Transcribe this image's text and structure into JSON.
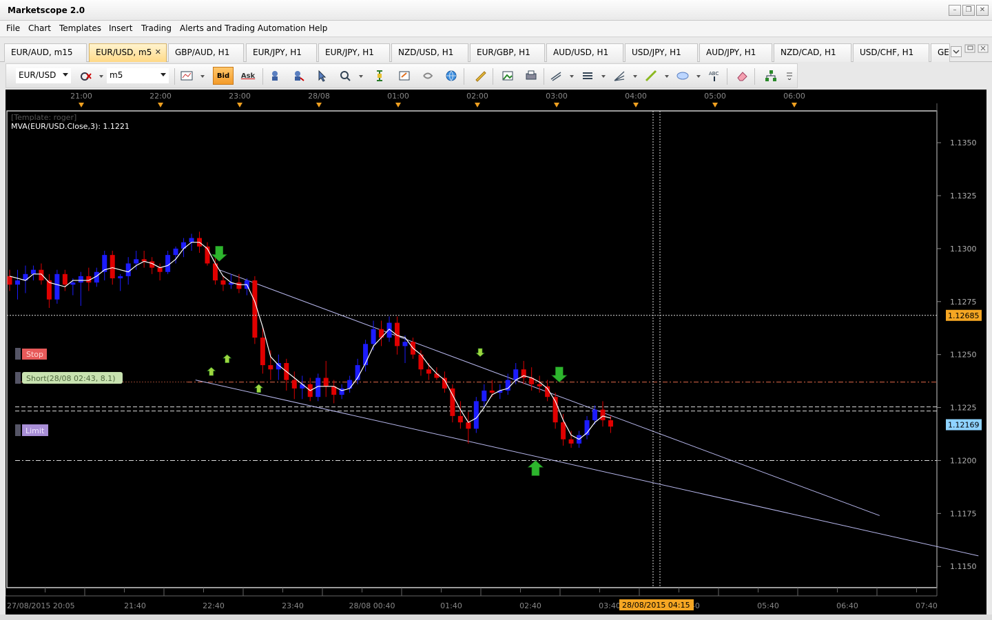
{
  "window": {
    "title": "Marketscope 2.0",
    "minimize": "–",
    "restore": "❐",
    "close": "✕"
  },
  "menu": [
    "File",
    "Chart",
    "Templates",
    "Insert",
    "Trading",
    "Alerts and Trading Automation",
    "Help"
  ],
  "tabs": [
    {
      "label": "EUR/AUD, m15",
      "active": false
    },
    {
      "label": "EUR/USD, m5",
      "active": true
    },
    {
      "label": "GBP/AUD, H1",
      "active": false
    },
    {
      "label": "EUR/JPY, H1",
      "active": false
    },
    {
      "label": "EUR/JPY, H1",
      "active": false
    },
    {
      "label": "NZD/USD, H1",
      "active": false
    },
    {
      "label": "EUR/GBP, H1",
      "active": false
    },
    {
      "label": "AUD/USD, H1",
      "active": false
    },
    {
      "label": "USD/JPY, H1",
      "active": false
    },
    {
      "label": "AUD/JPY, H1",
      "active": false
    },
    {
      "label": "NZD/CAD, H1",
      "active": false
    },
    {
      "label": "USD/CHF, H1",
      "active": false
    },
    {
      "label": "GE",
      "active": false
    }
  ],
  "tab_close": "✕",
  "toolbar": {
    "instrument": "EUR/USD",
    "timeframe": "m5",
    "bid_label": "Bid",
    "ask_label": "Ask",
    "tools": [
      "chart-type-icon",
      "bid-button",
      "ask-button",
      "indicator-icon",
      "strategy-icon",
      "cursor-icon",
      "zoom-icon",
      "signal-icon",
      "order-icon",
      "stream-icon",
      "globe-icon",
      "ruler-icon",
      "picture-icon",
      "print-icon",
      "line-tools-icon",
      "level-icon",
      "fibonacci-icon",
      "trendline-icon",
      "ellipse-icon",
      "text-icon",
      "eraser-icon",
      "hierarchy-icon",
      "more-icon"
    ]
  },
  "chart_data": {
    "type": "candlestick",
    "template_label": "[Template: roger]",
    "indicator_label": "MVA(EUR/USD.Close,3): 1.1221",
    "ylim": [
      1.114,
      1.1365
    ],
    "y_ticks": [
      "1.1350",
      "1.1325",
      "1.1300",
      "1.1275",
      "1.1250",
      "1.1225",
      "1.1200",
      "1.1175",
      "1.1150"
    ],
    "top_time_ticks": [
      "21:00",
      "22:00",
      "23:00",
      "28/08",
      "01:00",
      "02:00",
      "03:00",
      "04:00",
      "05:00",
      "06:00"
    ],
    "bottom_time_ticks": [
      "27/08/2015 20:05",
      "21:40",
      "22:40",
      "23:40",
      "28/08 00:40",
      "01:40",
      "02:40",
      "03:40",
      "04:40",
      "05:40",
      "06:40",
      "07:40"
    ],
    "cursor_time": "28/08/2015 04:15",
    "cursor_price": "1.12685",
    "last_price": "1.12169",
    "stop_label": "Stop",
    "stop_level": 1.1237,
    "limit_label": "Limit",
    "limit_level": 1.12,
    "position_label": "Short(28/08 02:43, 8.1)",
    "position_level": 1.1224,
    "colors": {
      "up": "#1c1cff",
      "down": "#e00000",
      "ma": "#ffffff",
      "trend": "#b8b8ee",
      "bg": "#000000",
      "axis_text": "#b0b0b0",
      "cursor_badge": "#f5a623",
      "price_badge": "#8fd3ff"
    },
    "candles": [
      [
        1.1287,
        1.129,
        1.128,
        1.1283
      ],
      [
        1.1283,
        1.129,
        1.1276,
        1.1285
      ],
      [
        1.1285,
        1.1292,
        1.1279,
        1.1288
      ],
      [
        1.1288,
        1.1292,
        1.1285,
        1.129
      ],
      [
        1.129,
        1.1293,
        1.1283,
        1.1285
      ],
      [
        1.1285,
        1.1288,
        1.1272,
        1.1276
      ],
      [
        1.1276,
        1.129,
        1.1274,
        1.1288
      ],
      [
        1.1288,
        1.129,
        1.128,
        1.1283
      ],
      [
        1.1283,
        1.1286,
        1.1278,
        1.1284
      ],
      [
        1.1284,
        1.1289,
        1.1273,
        1.1287
      ],
      [
        1.1287,
        1.1291,
        1.128,
        1.1284
      ],
      [
        1.1284,
        1.1291,
        1.1282,
        1.1289
      ],
      [
        1.1289,
        1.1299,
        1.1285,
        1.1297
      ],
      [
        1.1297,
        1.1299,
        1.1283,
        1.1286
      ],
      [
        1.1286,
        1.1288,
        1.128,
        1.1287
      ],
      [
        1.1287,
        1.1296,
        1.1283,
        1.1293
      ],
      [
        1.1293,
        1.1299,
        1.129,
        1.1295
      ],
      [
        1.1295,
        1.1299,
        1.1291,
        1.1294
      ],
      [
        1.1294,
        1.1296,
        1.1288,
        1.1291
      ],
      [
        1.1291,
        1.1293,
        1.1285,
        1.1289
      ],
      [
        1.1289,
        1.1299,
        1.1288,
        1.1297
      ],
      [
        1.1297,
        1.1301,
        1.1293,
        1.13
      ],
      [
        1.13,
        1.1305,
        1.1296,
        1.1303
      ],
      [
        1.1303,
        1.1307,
        1.1299,
        1.1305
      ],
      [
        1.1305,
        1.1308,
        1.1298,
        1.1301
      ],
      [
        1.1301,
        1.1303,
        1.1292,
        1.1293
      ],
      [
        1.1293,
        1.1296,
        1.1283,
        1.1285
      ],
      [
        1.1285,
        1.1287,
        1.128,
        1.1283
      ],
      [
        1.1283,
        1.1288,
        1.1281,
        1.1284
      ],
      [
        1.1284,
        1.1288,
        1.1279,
        1.1281
      ],
      [
        1.1281,
        1.1286,
        1.1278,
        1.1285
      ],
      [
        1.1285,
        1.1287,
        1.1255,
        1.1258
      ],
      [
        1.1258,
        1.1263,
        1.1241,
        1.1245
      ],
      [
        1.1245,
        1.1252,
        1.1238,
        1.1243
      ],
      [
        1.1243,
        1.125,
        1.1238,
        1.1246
      ],
      [
        1.1246,
        1.1248,
        1.1233,
        1.1238
      ],
      [
        1.1238,
        1.1242,
        1.1229,
        1.1234
      ],
      [
        1.1234,
        1.124,
        1.1229,
        1.1236
      ],
      [
        1.1236,
        1.1239,
        1.1228,
        1.123
      ],
      [
        1.123,
        1.1241,
        1.1228,
        1.1239
      ],
      [
        1.1239,
        1.1247,
        1.123,
        1.1235
      ],
      [
        1.1235,
        1.1238,
        1.1227,
        1.1231
      ],
      [
        1.1231,
        1.1236,
        1.1229,
        1.1234
      ],
      [
        1.1234,
        1.124,
        1.1232,
        1.1238
      ],
      [
        1.1238,
        1.1248,
        1.1236,
        1.1245
      ],
      [
        1.1245,
        1.1257,
        1.1242,
        1.1255
      ],
      [
        1.1255,
        1.1266,
        1.1252,
        1.1262
      ],
      [
        1.1262,
        1.1266,
        1.1254,
        1.1258
      ],
      [
        1.1258,
        1.1268,
        1.1256,
        1.1265
      ],
      [
        1.1265,
        1.1268,
        1.125,
        1.1254
      ],
      [
        1.1254,
        1.1259,
        1.1246,
        1.1256
      ],
      [
        1.1256,
        1.1258,
        1.1248,
        1.125
      ],
      [
        1.125,
        1.1252,
        1.124,
        1.1243
      ],
      [
        1.1243,
        1.1246,
        1.1238,
        1.1241
      ],
      [
        1.1241,
        1.1244,
        1.1238,
        1.1239
      ],
      [
        1.1239,
        1.1242,
        1.1232,
        1.1234
      ],
      [
        1.1234,
        1.1236,
        1.1218,
        1.1221
      ],
      [
        1.1221,
        1.1228,
        1.1215,
        1.1218
      ],
      [
        1.1218,
        1.1223,
        1.1208,
        1.1215
      ],
      [
        1.1215,
        1.123,
        1.1213,
        1.1228
      ],
      [
        1.1228,
        1.1236,
        1.1225,
        1.1233
      ],
      [
        1.1233,
        1.1238,
        1.123,
        1.1232
      ],
      [
        1.1232,
        1.1236,
        1.1229,
        1.1233
      ],
      [
        1.1233,
        1.1241,
        1.1231,
        1.1238
      ],
      [
        1.1238,
        1.1246,
        1.1236,
        1.1243
      ],
      [
        1.1243,
        1.1247,
        1.1236,
        1.1239
      ],
      [
        1.1239,
        1.1244,
        1.1233,
        1.1236
      ],
      [
        1.1236,
        1.124,
        1.1232,
        1.1235
      ],
      [
        1.1235,
        1.1238,
        1.1228,
        1.123
      ],
      [
        1.123,
        1.1232,
        1.1215,
        1.1218
      ],
      [
        1.1218,
        1.1222,
        1.1207,
        1.121
      ],
      [
        1.121,
        1.1214,
        1.1206,
        1.1208
      ],
      [
        1.1208,
        1.1214,
        1.1206,
        1.1212
      ],
      [
        1.1212,
        1.1221,
        1.121,
        1.1219
      ],
      [
        1.1219,
        1.1226,
        1.1217,
        1.1224
      ],
      [
        1.1224,
        1.1228,
        1.1216,
        1.1219
      ],
      [
        1.1219,
        1.1221,
        1.1213,
        1.1216
      ]
    ],
    "ma": [
      1.1287,
      1.1286,
      1.1285,
      1.1288,
      1.1288,
      1.1284,
      1.1283,
      1.1282,
      1.1285,
      1.1285,
      1.1285,
      1.1287,
      1.129,
      1.1291,
      1.129,
      1.1289,
      1.1292,
      1.1294,
      1.1293,
      1.1291,
      1.1292,
      1.1295,
      1.13,
      1.1303,
      1.1303,
      1.13,
      1.1293,
      1.1287,
      1.1284,
      1.1283,
      1.1283,
      1.1275,
      1.1263,
      1.1249,
      1.1245,
      1.1242,
      1.1239,
      1.1236,
      1.1233,
      1.1235,
      1.1235,
      1.1235,
      1.1233,
      1.1234,
      1.1239,
      1.1246,
      1.1254,
      1.1258,
      1.1262,
      1.1259,
      1.1258,
      1.1253,
      1.125,
      1.1245,
      1.1241,
      1.1238,
      1.1231,
      1.1224,
      1.1218,
      1.122,
      1.1225,
      1.1231,
      1.1233,
      1.1234,
      1.1238,
      1.124,
      1.1239,
      1.1237,
      1.1234,
      1.1228,
      1.1219,
      1.1212,
      1.121,
      1.1213,
      1.1218,
      1.1221,
      1.122
    ],
    "trend_upper": [
      [
        1.129,
        26.5
      ],
      [
        1.1174,
        110
      ]
    ],
    "trend_lower": [
      [
        1.1238,
        23.5
      ],
      [
        1.1155,
        122.5
      ]
    ],
    "signals": [
      {
        "type": "down",
        "index": 26.5,
        "price": 1.1294,
        "size": "large"
      },
      {
        "type": "up",
        "index": 25.5,
        "price": 1.1244,
        "size": "small"
      },
      {
        "type": "up",
        "index": 27.5,
        "price": 1.125,
        "size": "small"
      },
      {
        "type": "up",
        "index": 31.5,
        "price": 1.1236,
        "size": "small"
      },
      {
        "type": "down",
        "index": 59.5,
        "price": 1.1249,
        "size": "small"
      },
      {
        "type": "down",
        "index": 69.5,
        "price": 1.1237,
        "size": "large"
      },
      {
        "type": "up",
        "index": 66.5,
        "price": 1.12,
        "size": "large"
      }
    ]
  }
}
